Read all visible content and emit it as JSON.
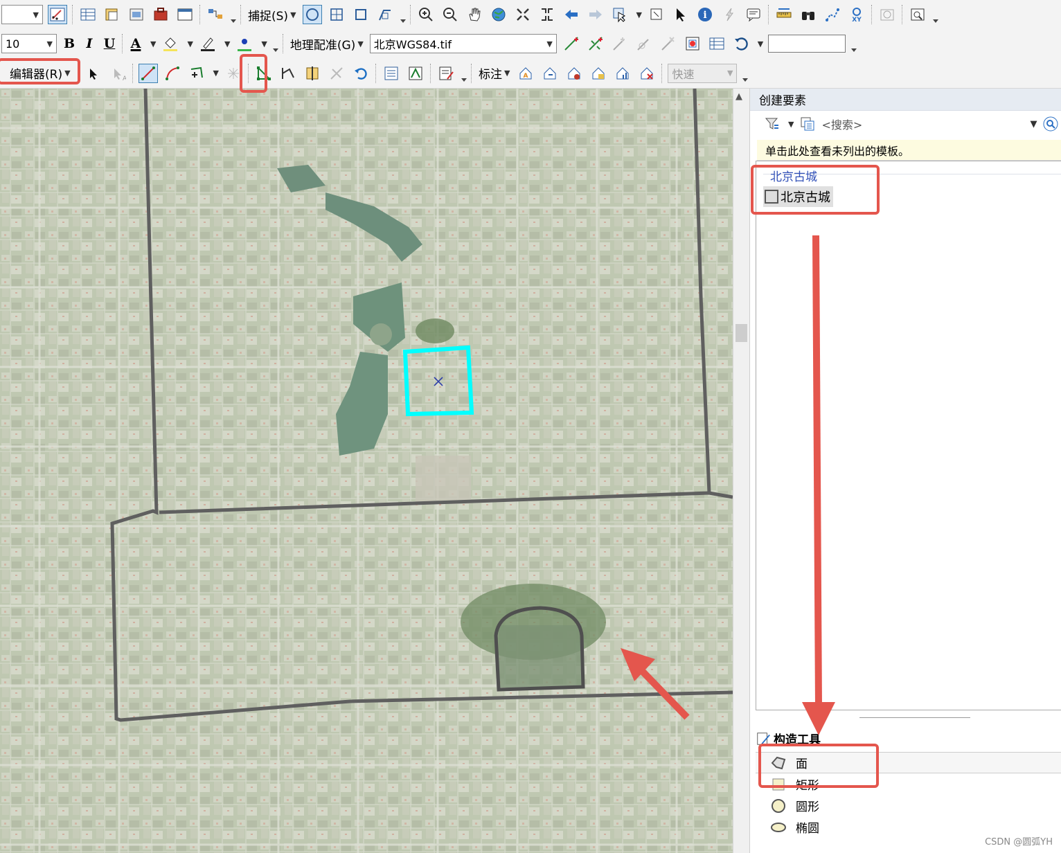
{
  "toolbar1": {
    "snap_label": "捕捉(S)"
  },
  "toolbar2": {
    "font_size": "10",
    "bold": "B",
    "italic": "I",
    "underline": "U",
    "font_color": "A",
    "georef_label": "地理配准(G)",
    "layer_select": "北京WGS84.tif"
  },
  "toolbar3": {
    "editor_label": "编辑器(R)",
    "label_menu": "标注",
    "quick_combo": "快速"
  },
  "panel": {
    "title": "创建要素",
    "search_placeholder": "<搜索>",
    "notice": "单击此处查看未列出的模板。",
    "group_name": "北京古城",
    "template_name": "北京古城",
    "construct_title": "构造工具",
    "tools": [
      "面",
      "矩形",
      "圆形",
      "椭圆"
    ]
  },
  "watermark": "CSDN @圆弧YH",
  "colors": {
    "accent_red": "#e4564d",
    "selection_cyan": "#00ffff",
    "boundary": "#5f5f5f"
  }
}
